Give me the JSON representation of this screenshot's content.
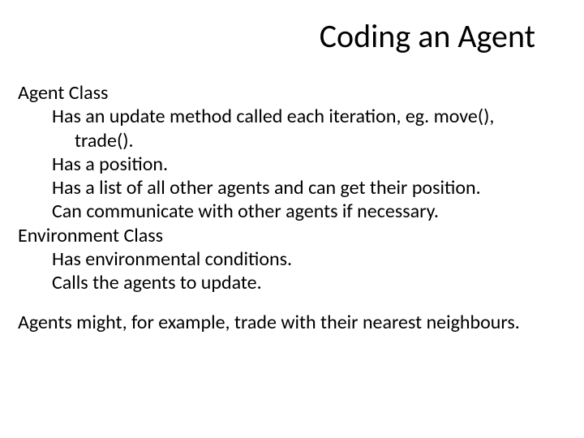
{
  "title": "Coding an Agent",
  "body": {
    "sec1_heading": "Agent Class",
    "sec1_item1a": "Has an update method called each iteration, eg. move(),",
    "sec1_item1b": "trade().",
    "sec1_item2": "Has a position.",
    "sec1_item3": "Has a list of all other agents and can get their position.",
    "sec1_item4": "Can communicate with other agents if necessary.",
    "sec2_heading": "Environment Class",
    "sec2_item1": "Has environmental conditions.",
    "sec2_item2": "Calls the agents to update.",
    "footnote": "Agents might, for example, trade with their nearest neighbours."
  }
}
